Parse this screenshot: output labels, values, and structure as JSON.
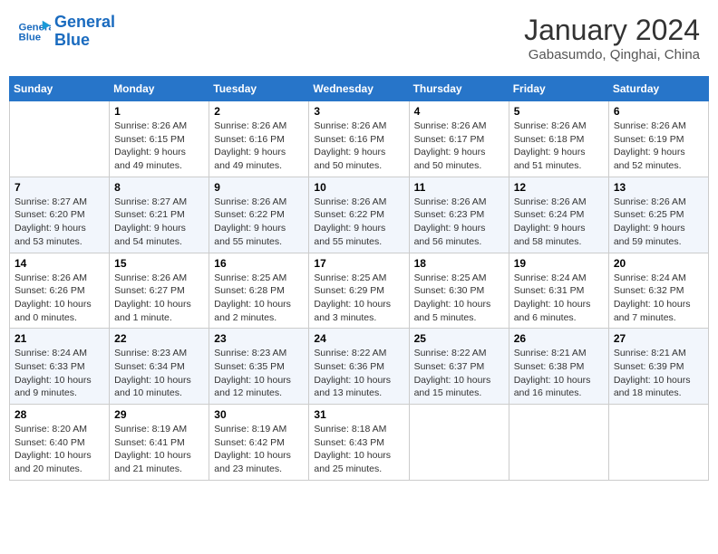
{
  "header": {
    "logo_line1": "General",
    "logo_line2": "Blue",
    "month_title": "January 2024",
    "subtitle": "Gabasumdo, Qinghai, China"
  },
  "weekdays": [
    "Sunday",
    "Monday",
    "Tuesday",
    "Wednesday",
    "Thursday",
    "Friday",
    "Saturday"
  ],
  "weeks": [
    [
      {
        "day": "",
        "sunrise": "",
        "sunset": "",
        "daylight": ""
      },
      {
        "day": "1",
        "sunrise": "Sunrise: 8:26 AM",
        "sunset": "Sunset: 6:15 PM",
        "daylight": "Daylight: 9 hours and 49 minutes."
      },
      {
        "day": "2",
        "sunrise": "Sunrise: 8:26 AM",
        "sunset": "Sunset: 6:16 PM",
        "daylight": "Daylight: 9 hours and 49 minutes."
      },
      {
        "day": "3",
        "sunrise": "Sunrise: 8:26 AM",
        "sunset": "Sunset: 6:16 PM",
        "daylight": "Daylight: 9 hours and 50 minutes."
      },
      {
        "day": "4",
        "sunrise": "Sunrise: 8:26 AM",
        "sunset": "Sunset: 6:17 PM",
        "daylight": "Daylight: 9 hours and 50 minutes."
      },
      {
        "day": "5",
        "sunrise": "Sunrise: 8:26 AM",
        "sunset": "Sunset: 6:18 PM",
        "daylight": "Daylight: 9 hours and 51 minutes."
      },
      {
        "day": "6",
        "sunrise": "Sunrise: 8:26 AM",
        "sunset": "Sunset: 6:19 PM",
        "daylight": "Daylight: 9 hours and 52 minutes."
      }
    ],
    [
      {
        "day": "7",
        "sunrise": "Sunrise: 8:27 AM",
        "sunset": "Sunset: 6:20 PM",
        "daylight": "Daylight: 9 hours and 53 minutes."
      },
      {
        "day": "8",
        "sunrise": "Sunrise: 8:27 AM",
        "sunset": "Sunset: 6:21 PM",
        "daylight": "Daylight: 9 hours and 54 minutes."
      },
      {
        "day": "9",
        "sunrise": "Sunrise: 8:26 AM",
        "sunset": "Sunset: 6:22 PM",
        "daylight": "Daylight: 9 hours and 55 minutes."
      },
      {
        "day": "10",
        "sunrise": "Sunrise: 8:26 AM",
        "sunset": "Sunset: 6:22 PM",
        "daylight": "Daylight: 9 hours and 55 minutes."
      },
      {
        "day": "11",
        "sunrise": "Sunrise: 8:26 AM",
        "sunset": "Sunset: 6:23 PM",
        "daylight": "Daylight: 9 hours and 56 minutes."
      },
      {
        "day": "12",
        "sunrise": "Sunrise: 8:26 AM",
        "sunset": "Sunset: 6:24 PM",
        "daylight": "Daylight: 9 hours and 58 minutes."
      },
      {
        "day": "13",
        "sunrise": "Sunrise: 8:26 AM",
        "sunset": "Sunset: 6:25 PM",
        "daylight": "Daylight: 9 hours and 59 minutes."
      }
    ],
    [
      {
        "day": "14",
        "sunrise": "Sunrise: 8:26 AM",
        "sunset": "Sunset: 6:26 PM",
        "daylight": "Daylight: 10 hours and 0 minutes."
      },
      {
        "day": "15",
        "sunrise": "Sunrise: 8:26 AM",
        "sunset": "Sunset: 6:27 PM",
        "daylight": "Daylight: 10 hours and 1 minute."
      },
      {
        "day": "16",
        "sunrise": "Sunrise: 8:25 AM",
        "sunset": "Sunset: 6:28 PM",
        "daylight": "Daylight: 10 hours and 2 minutes."
      },
      {
        "day": "17",
        "sunrise": "Sunrise: 8:25 AM",
        "sunset": "Sunset: 6:29 PM",
        "daylight": "Daylight: 10 hours and 3 minutes."
      },
      {
        "day": "18",
        "sunrise": "Sunrise: 8:25 AM",
        "sunset": "Sunset: 6:30 PM",
        "daylight": "Daylight: 10 hours and 5 minutes."
      },
      {
        "day": "19",
        "sunrise": "Sunrise: 8:24 AM",
        "sunset": "Sunset: 6:31 PM",
        "daylight": "Daylight: 10 hours and 6 minutes."
      },
      {
        "day": "20",
        "sunrise": "Sunrise: 8:24 AM",
        "sunset": "Sunset: 6:32 PM",
        "daylight": "Daylight: 10 hours and 7 minutes."
      }
    ],
    [
      {
        "day": "21",
        "sunrise": "Sunrise: 8:24 AM",
        "sunset": "Sunset: 6:33 PM",
        "daylight": "Daylight: 10 hours and 9 minutes."
      },
      {
        "day": "22",
        "sunrise": "Sunrise: 8:23 AM",
        "sunset": "Sunset: 6:34 PM",
        "daylight": "Daylight: 10 hours and 10 minutes."
      },
      {
        "day": "23",
        "sunrise": "Sunrise: 8:23 AM",
        "sunset": "Sunset: 6:35 PM",
        "daylight": "Daylight: 10 hours and 12 minutes."
      },
      {
        "day": "24",
        "sunrise": "Sunrise: 8:22 AM",
        "sunset": "Sunset: 6:36 PM",
        "daylight": "Daylight: 10 hours and 13 minutes."
      },
      {
        "day": "25",
        "sunrise": "Sunrise: 8:22 AM",
        "sunset": "Sunset: 6:37 PM",
        "daylight": "Daylight: 10 hours and 15 minutes."
      },
      {
        "day": "26",
        "sunrise": "Sunrise: 8:21 AM",
        "sunset": "Sunset: 6:38 PM",
        "daylight": "Daylight: 10 hours and 16 minutes."
      },
      {
        "day": "27",
        "sunrise": "Sunrise: 8:21 AM",
        "sunset": "Sunset: 6:39 PM",
        "daylight": "Daylight: 10 hours and 18 minutes."
      }
    ],
    [
      {
        "day": "28",
        "sunrise": "Sunrise: 8:20 AM",
        "sunset": "Sunset: 6:40 PM",
        "daylight": "Daylight: 10 hours and 20 minutes."
      },
      {
        "day": "29",
        "sunrise": "Sunrise: 8:19 AM",
        "sunset": "Sunset: 6:41 PM",
        "daylight": "Daylight: 10 hours and 21 minutes."
      },
      {
        "day": "30",
        "sunrise": "Sunrise: 8:19 AM",
        "sunset": "Sunset: 6:42 PM",
        "daylight": "Daylight: 10 hours and 23 minutes."
      },
      {
        "day": "31",
        "sunrise": "Sunrise: 8:18 AM",
        "sunset": "Sunset: 6:43 PM",
        "daylight": "Daylight: 10 hours and 25 minutes."
      },
      {
        "day": "",
        "sunrise": "",
        "sunset": "",
        "daylight": ""
      },
      {
        "day": "",
        "sunrise": "",
        "sunset": "",
        "daylight": ""
      },
      {
        "day": "",
        "sunrise": "",
        "sunset": "",
        "daylight": ""
      }
    ]
  ]
}
